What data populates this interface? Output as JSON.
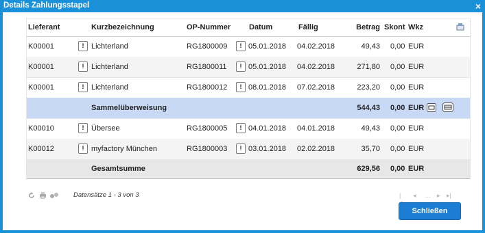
{
  "window": {
    "title": "Details Zahlungsstapel",
    "close_label": "×"
  },
  "table": {
    "headers": {
      "lieferant": "Lieferant",
      "kurz": "Kurzbezeichnung",
      "op": "OP-Nummer",
      "datum": "Datum",
      "faellig": "Fällig",
      "betrag": "Betrag",
      "skont": "Skont",
      "wkz": "Wkz"
    },
    "rows": [
      {
        "lieferant": "K00001",
        "kurz": "Lichterland",
        "op": "RG1800009",
        "datum": "05.01.2018",
        "faellig": "04.02.2018",
        "betrag": "49,43",
        "skont": "0,00",
        "wkz": "EUR"
      },
      {
        "lieferant": "K00001",
        "kurz": "Lichterland",
        "op": "RG1800011",
        "datum": "05.01.2018",
        "faellig": "04.02.2018",
        "betrag": "271,80",
        "skont": "0,00",
        "wkz": "EUR"
      },
      {
        "lieferant": "K00001",
        "kurz": "Lichterland",
        "op": "RG1800012",
        "datum": "08.01.2018",
        "faellig": "07.02.2018",
        "betrag": "223,20",
        "skont": "0,00",
        "wkz": "EUR"
      }
    ],
    "subtotal": {
      "label": "Sammelüberweisung",
      "betrag": "544,43",
      "skont": "0,00",
      "wkz": "EUR"
    },
    "rows2": [
      {
        "lieferant": "K00010",
        "kurz": "Übersee",
        "op": "RG1800005",
        "datum": "04.01.2018",
        "faellig": "04.01.2018",
        "betrag": "49,43",
        "skont": "0,00",
        "wkz": "EUR"
      },
      {
        "lieferant": "K00012",
        "kurz": "myfactory München",
        "op": "RG1800003",
        "datum": "03.01.2018",
        "faellig": "02.02.2018",
        "betrag": "35,70",
        "skont": "0,00",
        "wkz": "EUR"
      }
    ],
    "total": {
      "label": "Gesamtsumme",
      "betrag": "629,56",
      "skont": "0,00",
      "wkz": "EUR"
    }
  },
  "footer": {
    "status": "Datensätze 1 - 3 von 3",
    "pager_ellipsis": "...",
    "close_button": "Schließen"
  },
  "icons": [
    "refresh-icon",
    "print-icon",
    "settings-icon",
    "first-page-icon",
    "prev-page-icon",
    "next-page-icon",
    "last-page-icon",
    "export-icon",
    "letter-icon",
    "bank-icon",
    "excl-icon"
  ],
  "colors": {
    "titlebar": "#1a90d9",
    "subtotal_row": "#c8d9f6",
    "total_row": "#e7e7e7",
    "button": "#1b7dd3"
  }
}
